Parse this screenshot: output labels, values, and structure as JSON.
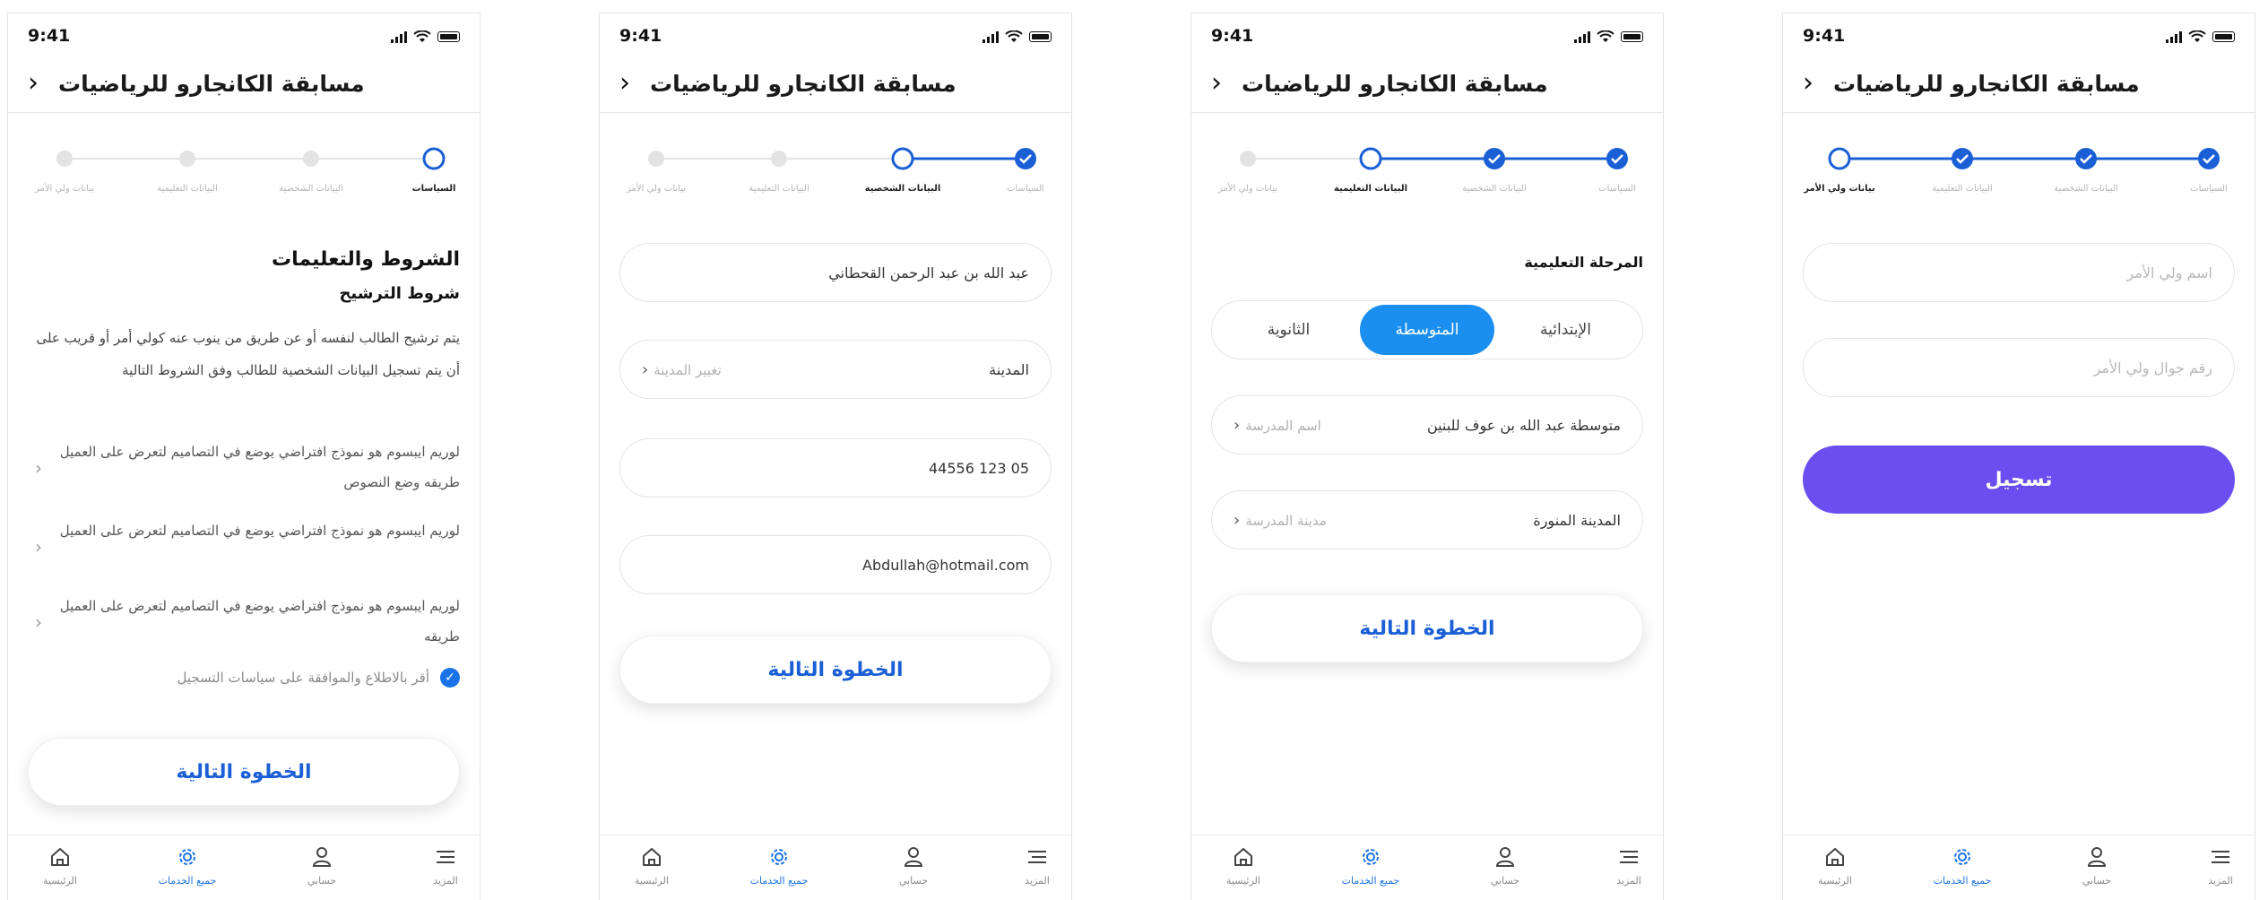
{
  "status": {
    "time": "9:41"
  },
  "header": {
    "title": "مسابقة الكانجارو للرياضيات",
    "back_icon": "chevron-left-icon"
  },
  "steps": {
    "labels": [
      "السياسات",
      "البيانات الشخصية",
      "البيانات التعليمية",
      "بيانات ولي الأمر"
    ]
  },
  "screen1": {
    "section_title": "الشروط والتعليمات",
    "subsection_title": "شروط الترشيح",
    "paragraph": "يتم ترشيح الطالب لنفسه أو عن طريق من ينوب عنه كولي أمر أو قريب على أن يتم تسجيل البيانات الشخصية للطالب وفق الشروط التالية",
    "bullets": [
      "لوريم ايبسوم هو نموذج افتراضي يوضع في التصاميم لتعرض على العميل طريقه وضع النصوص",
      "لوريم ايبسوم هو نموذج افتراضي يوضع في التصاميم لتعرض على العميل",
      "لوريم ايبسوم هو نموذج افتراضي يوضع في التصاميم لتعرض على العميل طريقه"
    ],
    "agree_label": "أقر بالاطلاع والموافقة على سياسات التسجيل",
    "next_label": "الخطوة التالية"
  },
  "screen2": {
    "name_value": "عبد الله بن عبد الرحمن القحطاني",
    "city_label": "المدينة",
    "city_action": "تغيير المدينة",
    "phone_value": "05 123 44556",
    "email_value": "Abdullah@hotmail.com",
    "next_label": "الخطوة التالية"
  },
  "screen3": {
    "edu_label": "المرحلة التعليمية",
    "levels": [
      "الإبتدائية",
      "المتوسطة",
      "الثانوية"
    ],
    "selected_level": "المتوسطة",
    "school_value": "متوسطة عبد الله بن عوف للبنين",
    "school_action": "اسم المدرسة",
    "school_city_value": "المدينة المنورة",
    "school_city_action": "مدينة المدرسة",
    "next_label": "الخطوة التالية"
  },
  "screen4": {
    "guardian_name_placeholder": "اسم ولي الأمر",
    "guardian_phone_placeholder": "رقم جوال ولي الأمر",
    "submit_label": "تسجيل"
  },
  "tabbar": {
    "items": [
      {
        "label": "الرئيسية",
        "icon": "home-icon"
      },
      {
        "label": "جميع الخدمات",
        "icon": "services-gear-icon"
      },
      {
        "label": "حسابي",
        "icon": "user-icon"
      },
      {
        "label": "المزيد",
        "icon": "menu-icon"
      }
    ],
    "active_index": 1
  },
  "colors": {
    "accent_blue": "#1a5fd6",
    "segment_blue": "#1a8ff0",
    "submit_purple": "#6a4ef0",
    "inactive_step": "#d9d9d9"
  }
}
